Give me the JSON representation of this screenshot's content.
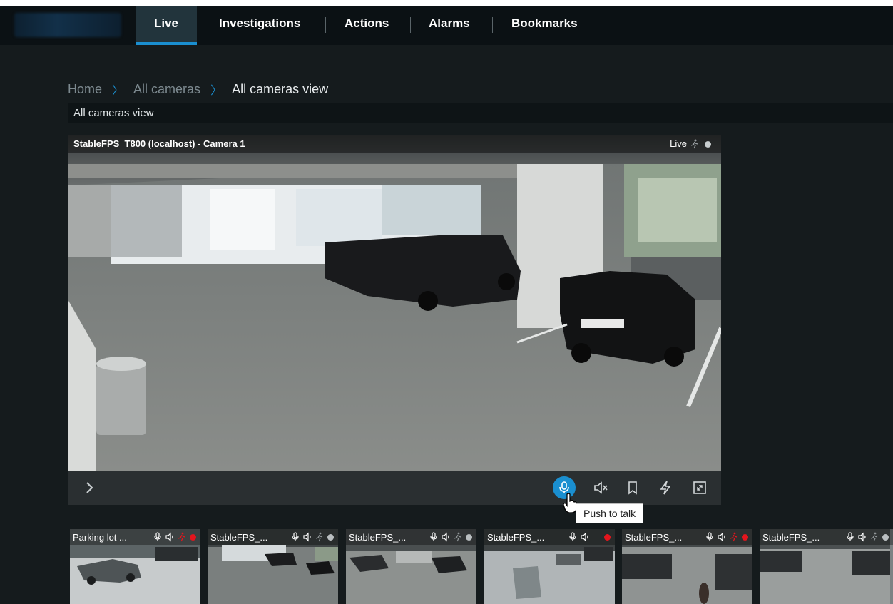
{
  "nav": {
    "tabs": [
      {
        "label": "Live",
        "active": true
      },
      {
        "label": "Investigations",
        "active": false
      },
      {
        "label": "Actions",
        "active": false
      },
      {
        "label": "Alarms",
        "active": false
      },
      {
        "label": "Bookmarks",
        "active": false
      }
    ]
  },
  "breadcrumb": {
    "items": [
      "Home",
      "All cameras",
      "All cameras view"
    ]
  },
  "view": {
    "title": "All cameras view"
  },
  "main_camera": {
    "name": "StableFPS_T800 (localhost) - Camera 1",
    "status": "Live",
    "icons": {
      "expand": "chevron-right-icon",
      "mic": "microphone-icon",
      "speaker": "speaker-muted-icon",
      "bookmark": "bookmark-icon",
      "flash": "lightning-icon",
      "fullscreen": "fullscreen-icon"
    }
  },
  "tooltip": {
    "text": "Push to talk"
  },
  "thumbnails": [
    {
      "name": "Parking lot ...",
      "motion": true,
      "recording": true
    },
    {
      "name": "StableFPS_...",
      "motion": false,
      "recording": false
    },
    {
      "name": "StableFPS_...",
      "motion": false,
      "recording": false
    },
    {
      "name": "StableFPS_...",
      "motion": false,
      "recording": true
    },
    {
      "name": "StableFPS_...",
      "motion": true,
      "recording": true
    },
    {
      "name": "StableFPS_...",
      "motion": false,
      "recording": false
    }
  ],
  "colors": {
    "accent": "#1a8fd0",
    "recording": "#e4151d",
    "background": "#151b1d",
    "navbar": "#0b1114"
  }
}
